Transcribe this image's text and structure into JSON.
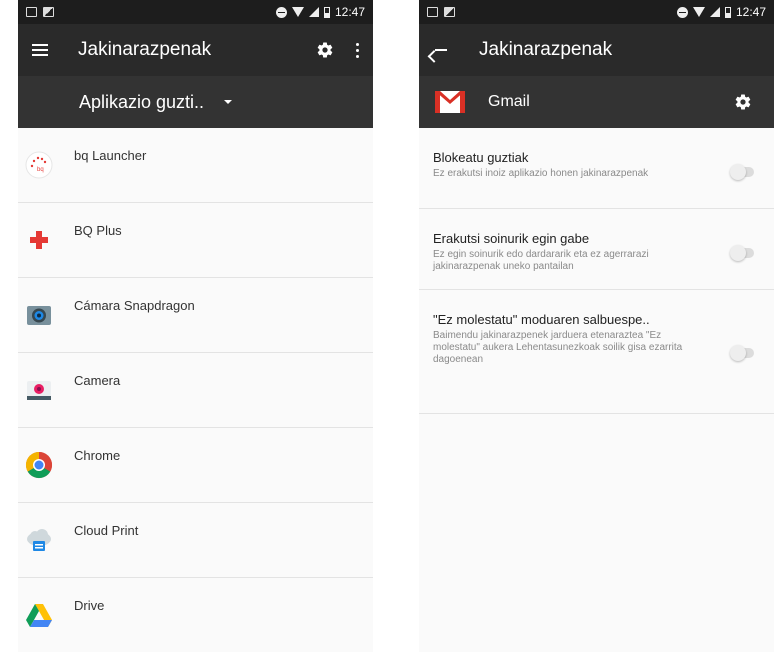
{
  "left": {
    "status": {
      "time": "12:47"
    },
    "toolbar": {
      "title": "Jakinarazpenak"
    },
    "filter": {
      "label": "Aplikazio guzti.."
    },
    "apps": [
      {
        "label": "bq Launcher",
        "icon": "bq-launcher-icon"
      },
      {
        "label": "BQ Plus",
        "icon": "bq-plus-icon"
      },
      {
        "label": "Cámara Snapdragon",
        "icon": "camera-snapdragon-icon"
      },
      {
        "label": "Camera",
        "icon": "camera-icon"
      },
      {
        "label": "Chrome",
        "icon": "chrome-icon"
      },
      {
        "label": "Cloud Print",
        "icon": "cloud-print-icon"
      },
      {
        "label": "Drive",
        "icon": "drive-icon"
      }
    ]
  },
  "right": {
    "status": {
      "time": "12:47"
    },
    "toolbar": {
      "title": "Jakinarazpenak"
    },
    "app": {
      "name": "Gmail"
    },
    "settings": [
      {
        "title": "Blokeatu guztiak",
        "desc": "Ez erakutsi inoiz aplikazio honen jakinarazpenak",
        "enabled": false
      },
      {
        "title": "Erakutsi soinurik egin gabe",
        "desc": "Ez egin soinurik edo dardararik eta ez agerrarazi jakinarazpenak uneko pantailan",
        "enabled": false
      },
      {
        "title": "\"Ez molestatu\" moduaren salbuespe..",
        "desc": "Baimendu jakinarazpenek jarduera etenaraztea \"Ez molestatu\" aukera Lehentasunezkoak soilik gisa ezarrita dagoenean",
        "enabled": false
      }
    ]
  },
  "colors": {
    "toolbar": "#2a2a2a",
    "subbar": "#333333",
    "statusbar": "#1d1d1d",
    "gmail_red": "#d93025"
  }
}
